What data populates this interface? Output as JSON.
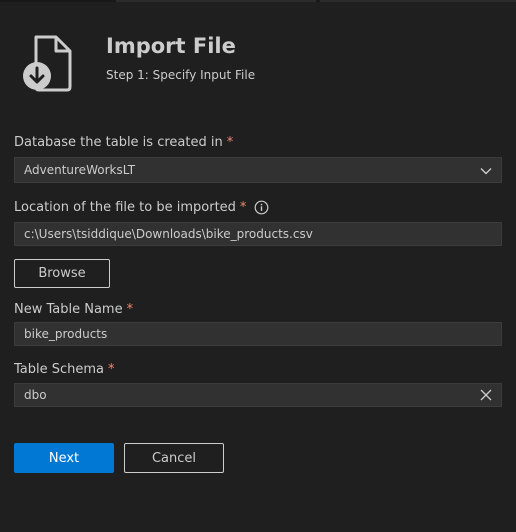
{
  "header": {
    "title": "Import File",
    "subtitle": "Step 1: Specify Input File",
    "icon": "file-import-icon"
  },
  "form": {
    "database": {
      "label": "Database the table is created in",
      "required_mark": "*",
      "value": "AdventureWorksLT",
      "icon": "chevron-down-icon"
    },
    "file_location": {
      "label": "Location of the file to be imported",
      "required_mark": "*",
      "value": "c:\\Users\\tsiddique\\Downloads\\bike_products.csv",
      "info_icon": "info-icon"
    },
    "browse_label": "Browse",
    "table_name": {
      "label": "New Table Name",
      "required_mark": "*",
      "value": "bike_products"
    },
    "table_schema": {
      "label": "Table Schema",
      "required_mark": "*",
      "value": "dbo",
      "clear_icon": "close-icon"
    }
  },
  "footer": {
    "next_label": "Next",
    "cancel_label": "Cancel"
  },
  "colors": {
    "background": "#1f1f1f",
    "input_background": "#313131",
    "primary": "#0078d4",
    "required": "#f48771",
    "text": "#cccccc"
  }
}
